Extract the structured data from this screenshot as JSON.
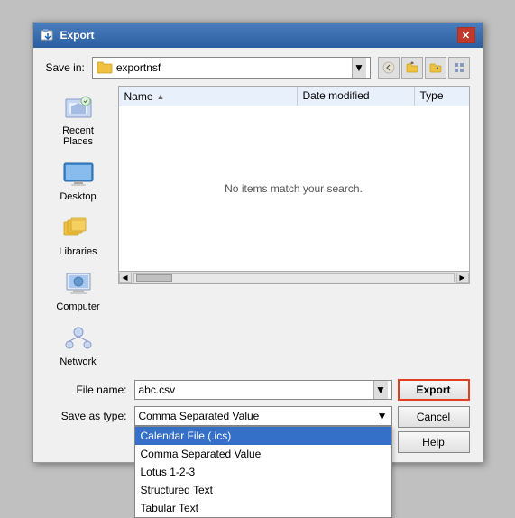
{
  "dialog": {
    "title": "Export",
    "close_btn_label": "✕"
  },
  "save_in": {
    "label": "Save in:",
    "current_folder": "exportnsf",
    "arrow": "▼"
  },
  "toolbar": {
    "back_label": "←",
    "up_label": "↑",
    "new_folder_label": "📁",
    "view_label": "▦"
  },
  "file_list": {
    "col_name": "Name",
    "col_sort_arrow": "▲",
    "col_date": "Date modified",
    "col_type": "Type",
    "empty_message": "No items match your search."
  },
  "nav_items": [
    {
      "id": "recent-places",
      "label": "Recent Places"
    },
    {
      "id": "desktop",
      "label": "Desktop"
    },
    {
      "id": "libraries",
      "label": "Libraries"
    },
    {
      "id": "computer",
      "label": "Computer"
    },
    {
      "id": "network",
      "label": "Network"
    }
  ],
  "form": {
    "file_name_label": "File name:",
    "file_name_value": "abc.csv",
    "save_type_label": "Save as type:",
    "save_type_value": "Comma Separated Value"
  },
  "dropdown_options": [
    {
      "label": "Calendar File (.ics)",
      "selected": true
    },
    {
      "label": "Comma Separated Value",
      "selected": false
    },
    {
      "label": "Lotus 1-2-3",
      "selected": false
    },
    {
      "label": "Structured Text",
      "selected": false
    },
    {
      "label": "Tabular Text",
      "selected": false
    }
  ],
  "buttons": {
    "export_label": "Export",
    "cancel_label": "Cancel",
    "help_label": "Help"
  }
}
